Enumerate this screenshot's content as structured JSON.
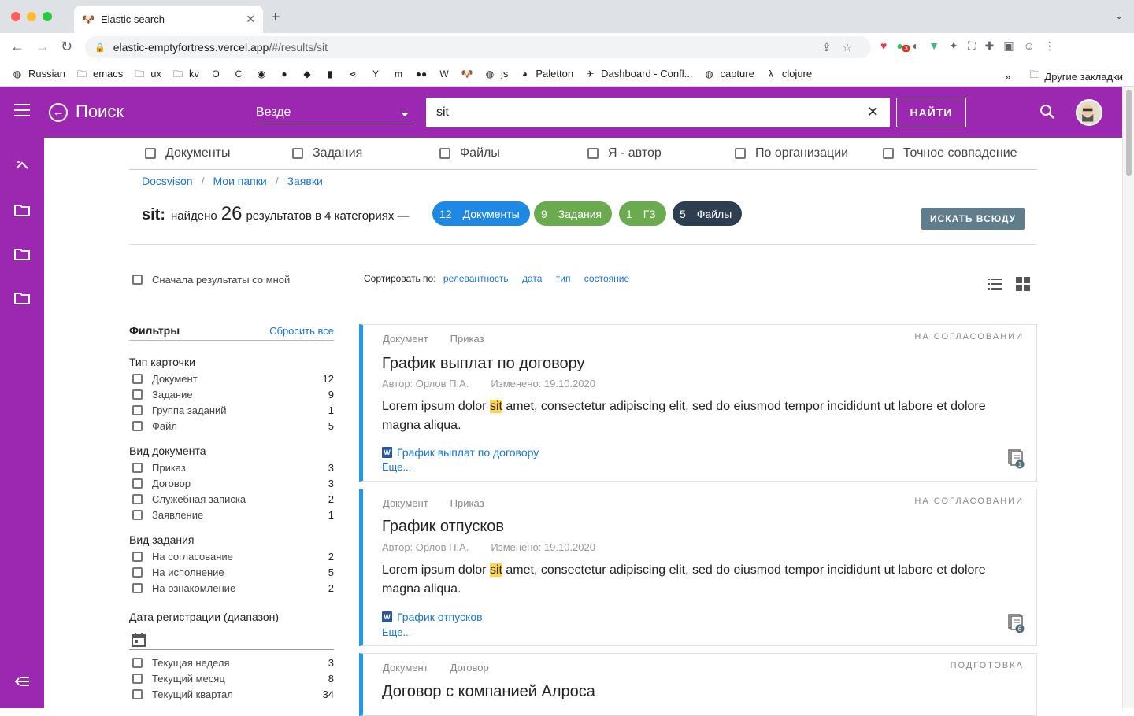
{
  "browser": {
    "tab_title": "Elastic search",
    "url_host": "elastic-emptyfortress.vercel.app",
    "url_path": "/#/results/sit",
    "bookmarks": [
      {
        "label": "Russian",
        "icon": "globe-icon"
      },
      {
        "label": "emacs",
        "icon": "folder-icon"
      },
      {
        "label": "ux",
        "icon": "folder-icon"
      },
      {
        "label": "kv",
        "icon": "folder-icon"
      },
      {
        "label": "",
        "icon": "outlook-icon"
      },
      {
        "label": "",
        "icon": "c-icon"
      },
      {
        "label": "",
        "icon": "whatsapp-icon"
      },
      {
        "label": "",
        "icon": "reddit-icon"
      },
      {
        "label": "",
        "icon": "app-icon"
      },
      {
        "label": "",
        "icon": "terminal-icon"
      },
      {
        "label": "",
        "icon": "share-icon"
      },
      {
        "label": "",
        "icon": "yc-icon"
      },
      {
        "label": "",
        "icon": "m-icon"
      },
      {
        "label": "",
        "icon": "medium-icon"
      },
      {
        "label": "",
        "icon": "wiki-icon"
      },
      {
        "label": "",
        "icon": "dog-icon"
      },
      {
        "label": "js",
        "icon": "globe-icon"
      },
      {
        "label": "Paletton",
        "icon": "paletton-icon"
      },
      {
        "label": "Dashboard - Confl...",
        "icon": "confluence-icon"
      },
      {
        "label": "capture",
        "icon": "globe-icon"
      },
      {
        "label": "clojure",
        "icon": "clojure-icon"
      }
    ],
    "other_bookmarks": "Другие закладки",
    "extension_badge": "3"
  },
  "app": {
    "title": "Поиск",
    "scope": "Везде",
    "query": "sit",
    "find_button": "НАЙТИ",
    "accent": "#9c27b0"
  },
  "type_filters": [
    "Документы",
    "Задания",
    "Файлы",
    "Я - автор",
    "По организации",
    "Точное совпадение"
  ],
  "breadcrumbs": [
    "Docsvison",
    "Мои папки",
    "Заявки"
  ],
  "summary": {
    "query": "sit:",
    "found": "найдено",
    "count": "26",
    "rest": "результатов в 4 категориях —"
  },
  "chips": [
    {
      "count": "12",
      "label": "Документы",
      "color": "#1e88e5"
    },
    {
      "count": "9",
      "label": "Задания",
      "color": "#6aab4f"
    },
    {
      "count": "1",
      "label": "ГЗ",
      "color": "#6aab4f"
    },
    {
      "count": "5",
      "label": "Файлы",
      "color": "#2c3e50"
    }
  ],
  "search_everywhere": "ИСКАТЬ ВСЮДУ",
  "me_first": "Сначала результаты со мной",
  "sort": {
    "label": "Сортировать по:",
    "options": [
      "релевантность",
      "дата",
      "тип",
      "состояние"
    ]
  },
  "filters": {
    "title": "Фильтры",
    "reset": "Сбросить все",
    "groups": [
      {
        "title": "Тип карточки",
        "items": [
          {
            "label": "Документ",
            "count": "12"
          },
          {
            "label": "Задание",
            "count": "9"
          },
          {
            "label": "Группа заданий",
            "count": "1"
          },
          {
            "label": "Файл",
            "count": "5"
          }
        ]
      },
      {
        "title": "Вид документа",
        "items": [
          {
            "label": "Приказ",
            "count": "3"
          },
          {
            "label": "Договор",
            "count": "3"
          },
          {
            "label": "Служебная записка",
            "count": "2"
          },
          {
            "label": "Заявление",
            "count": "1"
          }
        ]
      },
      {
        "title": "Вид задания",
        "items": [
          {
            "label": "На согласование",
            "count": "2"
          },
          {
            "label": "На исполнение",
            "count": "5"
          },
          {
            "label": "На ознакомление",
            "count": "2"
          }
        ]
      }
    ],
    "date_group": {
      "title": "Дата регистрации (диапазон)",
      "items": [
        {
          "label": "Текущая неделя",
          "count": "3"
        },
        {
          "label": "Текущий месяц",
          "count": "8"
        },
        {
          "label": "Текущий квартал",
          "count": "34"
        }
      ]
    }
  },
  "results": [
    {
      "type": "Документ",
      "kind": "Приказ",
      "status": "НА СОГЛАСОВАНИИ",
      "title": "График выплат по договору",
      "author": "Автор: Орлов П.А.",
      "changed": "Изменено: 19.10.2020",
      "text_before": "Lorem ipsum dolor ",
      "highlight": "sit",
      "text_after": " amet, consectetur adipiscing elit, sed do eiusmod tempor incididunt ut labore et dolore magna aliqua.",
      "file": "График выплат по договору",
      "file_icon_letter": "W",
      "more": "Еще...",
      "attachments": "1"
    },
    {
      "type": "Документ",
      "kind": "Приказ",
      "status": "НА СОГЛАСОВАНИИ",
      "title": "График отпусков",
      "author": "Автор: Орлов П.А.",
      "changed": "Изменено: 19.10.2020",
      "text_before": "Lorem ipsum dolor ",
      "highlight": "sit",
      "text_after": " amet, consectetur adipiscing elit, sed do eiusmod tempor incididunt ut labore et dolore magna aliqua.",
      "file": "График отпусков",
      "file_icon_letter": "W",
      "more": "Еще...",
      "attachments": "6"
    },
    {
      "type": "Документ",
      "kind": "Договор",
      "status": "ПОДГОТОВКА",
      "title": "Договор с компанией Алроса"
    }
  ]
}
